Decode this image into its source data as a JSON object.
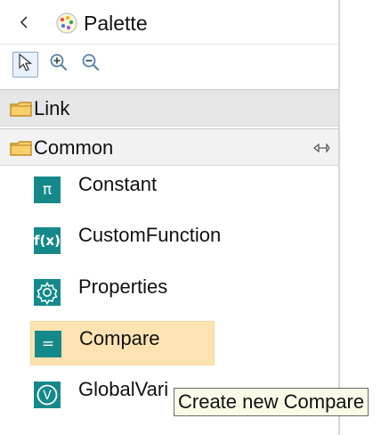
{
  "header": {
    "title": "Palette",
    "collapse_icon": "chevron-left-icon",
    "palette_icon": "palette-icon"
  },
  "toolbar": {
    "tools": [
      {
        "icon": "selection-arrow-icon",
        "selected": true
      },
      {
        "icon": "zoom-in-icon",
        "selected": false
      },
      {
        "icon": "zoom-out-icon",
        "selected": false
      }
    ]
  },
  "drawers": {
    "link": {
      "label": "Link",
      "icon": "folder-icon"
    },
    "common": {
      "label": "Common",
      "icon": "folder-icon",
      "pin_icon": "pin-icon"
    }
  },
  "entries": [
    {
      "label": "Constant",
      "icon": "pi-icon",
      "glyph": "π"
    },
    {
      "label": "CustomFunction",
      "icon": "function-icon",
      "glyph": "f(x)"
    },
    {
      "label": "Properties",
      "icon": "gear-icon",
      "glyph": ""
    },
    {
      "label": "Compare",
      "icon": "equals-icon",
      "glyph": "=",
      "highlighted": true
    },
    {
      "label": "GlobalVari",
      "icon": "variable-icon",
      "glyph": "V"
    }
  ],
  "tooltip": {
    "text": "Create new Compare"
  },
  "colors": {
    "entry_icon": "#15898a",
    "highlight": "#fde3b2",
    "drawer": "#e6e6e6"
  }
}
